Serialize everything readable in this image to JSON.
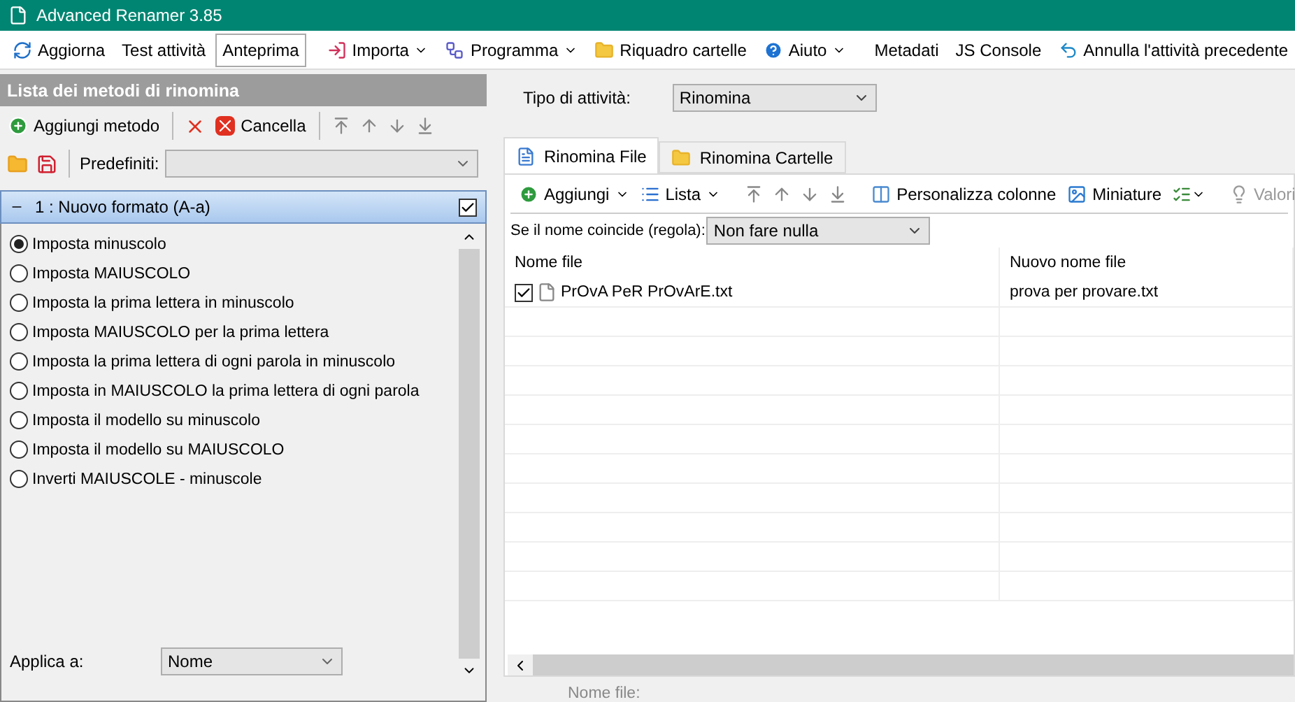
{
  "window": {
    "title": "Advanced Renamer 3.85"
  },
  "toolbar": {
    "items": [
      {
        "label": "Aggiorna",
        "dropdown": false,
        "selected": false
      },
      {
        "label": "Test attività",
        "dropdown": false,
        "selected": false
      },
      {
        "label": "Anteprima",
        "dropdown": false,
        "selected": true
      },
      {
        "label": "Importa",
        "dropdown": true,
        "selected": false
      },
      {
        "label": "Programma",
        "dropdown": true,
        "selected": false
      },
      {
        "label": "Riquadro cartelle",
        "dropdown": false,
        "selected": false
      },
      {
        "label": "Aiuto",
        "dropdown": true,
        "selected": false
      },
      {
        "label": "Metadati",
        "dropdown": false,
        "selected": false
      },
      {
        "label": "JS Console",
        "dropdown": false,
        "selected": false
      },
      {
        "label": "Annulla l'attività precedente",
        "dropdown": false,
        "selected": false
      }
    ]
  },
  "methods_panel": {
    "title": "Lista dei metodi di rinomina",
    "add_button": "Aggiungi metodo",
    "clear_button": "Cancella",
    "presets_label": "Predefiniti:",
    "method": {
      "title": "1 : Nuovo formato (A-a)",
      "expanded": true,
      "checked": true,
      "options": [
        {
          "label": "Imposta minuscolo",
          "selected": true
        },
        {
          "label": "Imposta MAIUSCOLO",
          "selected": false
        },
        {
          "label": "Imposta la prima lettera in minuscolo",
          "selected": false
        },
        {
          "label": "Imposta MAIUSCOLO per la prima lettera",
          "selected": false
        },
        {
          "label": "Imposta la prima lettera di ogni parola in minuscolo",
          "selected": false
        },
        {
          "label": "Imposta in MAIUSCOLO la prima lettera di ogni parola",
          "selected": false
        },
        {
          "label": "Imposta il modello su minuscolo",
          "selected": false
        },
        {
          "label": "Imposta il modello su MAIUSCOLO",
          "selected": false
        },
        {
          "label": "Inverti MAIUSCOLE - minuscole",
          "selected": false
        }
      ],
      "apply_to_label": "Applica a:",
      "apply_to_value": "Nome"
    }
  },
  "task": {
    "label": "Tipo di attività:",
    "value": "Rinomina"
  },
  "tabs": [
    {
      "label": "Rinomina File",
      "selected": true
    },
    {
      "label": "Rinomina Cartelle",
      "selected": false
    }
  ],
  "list_toolbar": {
    "add": "Aggiungi",
    "list": "Lista",
    "columns": "Personalizza colonne",
    "thumbnails": "Miniature",
    "values": "Valori"
  },
  "collision": {
    "label": "Se il nome coincide (regola):",
    "value": "Non fare nulla"
  },
  "table": {
    "columns": [
      "Nome file",
      "Nuovo nome file"
    ],
    "rows": [
      {
        "checked": true,
        "name": "PrOvA PeR PrOvArE.txt",
        "new_name": "prova per provare.txt"
      }
    ]
  },
  "footer": {
    "label": "Nome file:"
  }
}
